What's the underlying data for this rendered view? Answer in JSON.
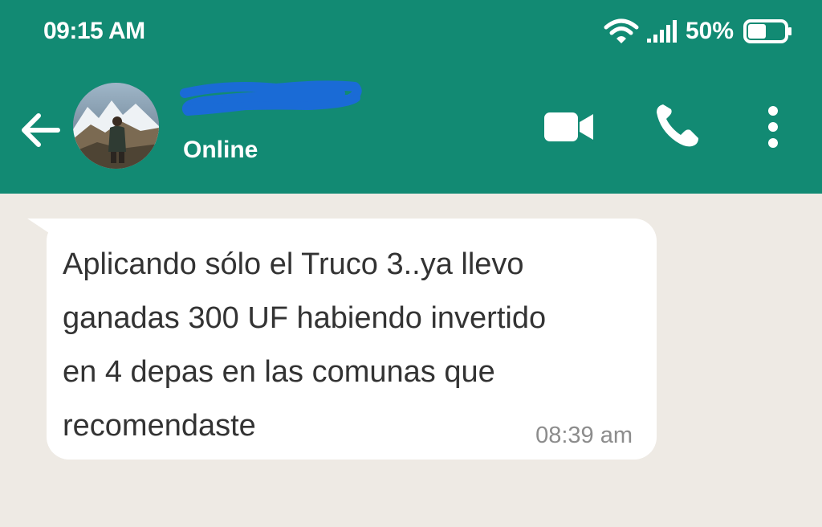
{
  "status_bar": {
    "time": "09:15 AM",
    "battery_percent": "50%",
    "battery_level": 0.5,
    "wifi_icon": "wifi-icon",
    "signal_icon": "signal-icon",
    "battery_icon": "battery-icon"
  },
  "header": {
    "back_icon": "back-arrow-icon",
    "contact_status": "Online",
    "video_icon": "video-call-icon",
    "call_icon": "phone-icon",
    "more_icon": "more-vertical-icon",
    "background_color": "#128a73",
    "name_redaction_color": "#1a6bd6"
  },
  "chat": {
    "background_color": "#eeeae4",
    "message": {
      "text": " Aplicando sólo el Truco 3..ya llevo\nganadas 300 UF habiendo invertido\nen 4 depas en las comunas que\nrecomendaste",
      "time": "08:39 am"
    }
  }
}
